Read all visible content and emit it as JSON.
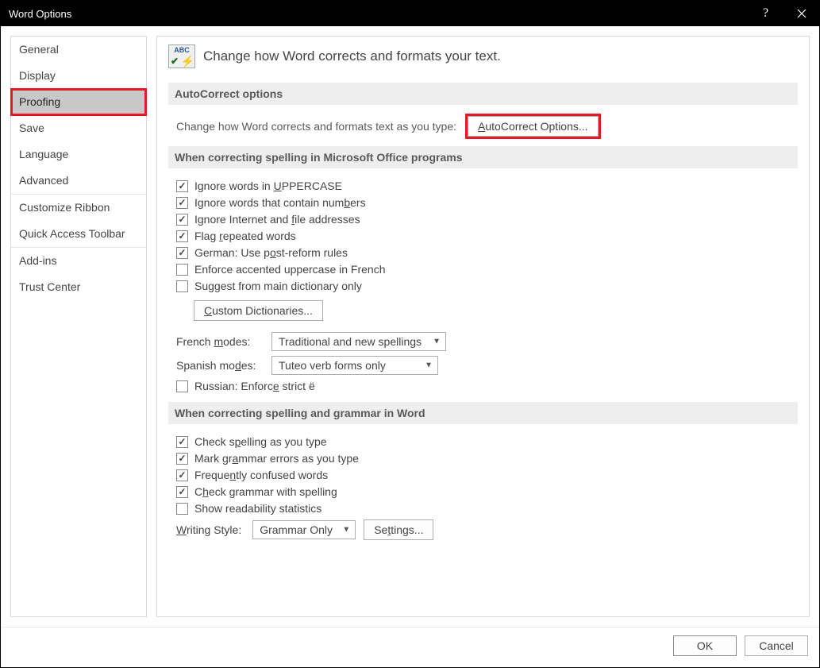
{
  "titlebar": {
    "title": "Word Options"
  },
  "sidebar": {
    "items": [
      {
        "label": "General"
      },
      {
        "label": "Display"
      },
      {
        "label": "Proofing",
        "selected": true,
        "highlight": true
      },
      {
        "label": "Save"
      },
      {
        "label": "Language"
      },
      {
        "label": "Advanced"
      },
      {
        "label": "Customize Ribbon"
      },
      {
        "label": "Quick Access Toolbar"
      },
      {
        "label": "Add-ins"
      },
      {
        "label": "Trust Center"
      }
    ]
  },
  "header": {
    "icon_text": "ABC",
    "text": "Change how Word corrects and formats your text."
  },
  "sections": {
    "autocorrect": {
      "title": "AutoCorrect options",
      "desc": "Change how Word corrects and formats text as you type:",
      "button": "AutoCorrect Options..."
    },
    "spelling_office": {
      "title": "When correcting spelling in Microsoft Office programs",
      "checks": [
        {
          "label_pre": "Ignore words in ",
          "label_u": "U",
          "label_post": "PPERCASE",
          "checked": true
        },
        {
          "label_pre": "Ignore words that contain num",
          "label_u": "b",
          "label_post": "ers",
          "checked": true
        },
        {
          "label_pre": "Ignore Internet and ",
          "label_u": "f",
          "label_post": "ile addresses",
          "checked": true
        },
        {
          "label_pre": "Flag ",
          "label_u": "r",
          "label_post": "epeated words",
          "checked": true
        },
        {
          "label_pre": "German: Use p",
          "label_u": "o",
          "label_post": "st-reform rules",
          "checked": true
        },
        {
          "label_pre": "Enforce accented uppercase in French",
          "label_u": "",
          "label_post": "",
          "checked": false
        },
        {
          "label_pre": "Suggest from main dictionary only",
          "label_u": "",
          "label_post": "",
          "checked": false
        }
      ],
      "custom_dict_button": "Custom Dictionaries...",
      "french_label": "French modes:",
      "french_value": "Traditional and new spellings",
      "spanish_label": "Spanish modes:",
      "spanish_value": "Tuteo verb forms only",
      "russian": {
        "label_pre": "Russian: Enforc",
        "label_u": "e",
        "label_post": " strict ё",
        "checked": false
      }
    },
    "spelling_word": {
      "title": "When correcting spelling and grammar in Word",
      "checks": [
        {
          "label_pre": "Check s",
          "label_u": "p",
          "label_post": "elling as you type",
          "checked": true
        },
        {
          "label_pre": "Mark gr",
          "label_u": "a",
          "label_post": "mmar errors as you type",
          "checked": true
        },
        {
          "label_pre": "Freque",
          "label_u": "n",
          "label_post": "tly confused words",
          "checked": true
        },
        {
          "label_pre": "C",
          "label_u": "h",
          "label_post": "eck grammar with spelling",
          "checked": true
        },
        {
          "label_pre": "Show readability statistics",
          "label_u": "",
          "label_post": "",
          "checked": false
        }
      ],
      "writing_style_label": "Writing Style:",
      "writing_style_value": "Grammar Only",
      "settings_button": "Settings..."
    }
  },
  "footer": {
    "ok": "OK",
    "cancel": "Cancel"
  }
}
